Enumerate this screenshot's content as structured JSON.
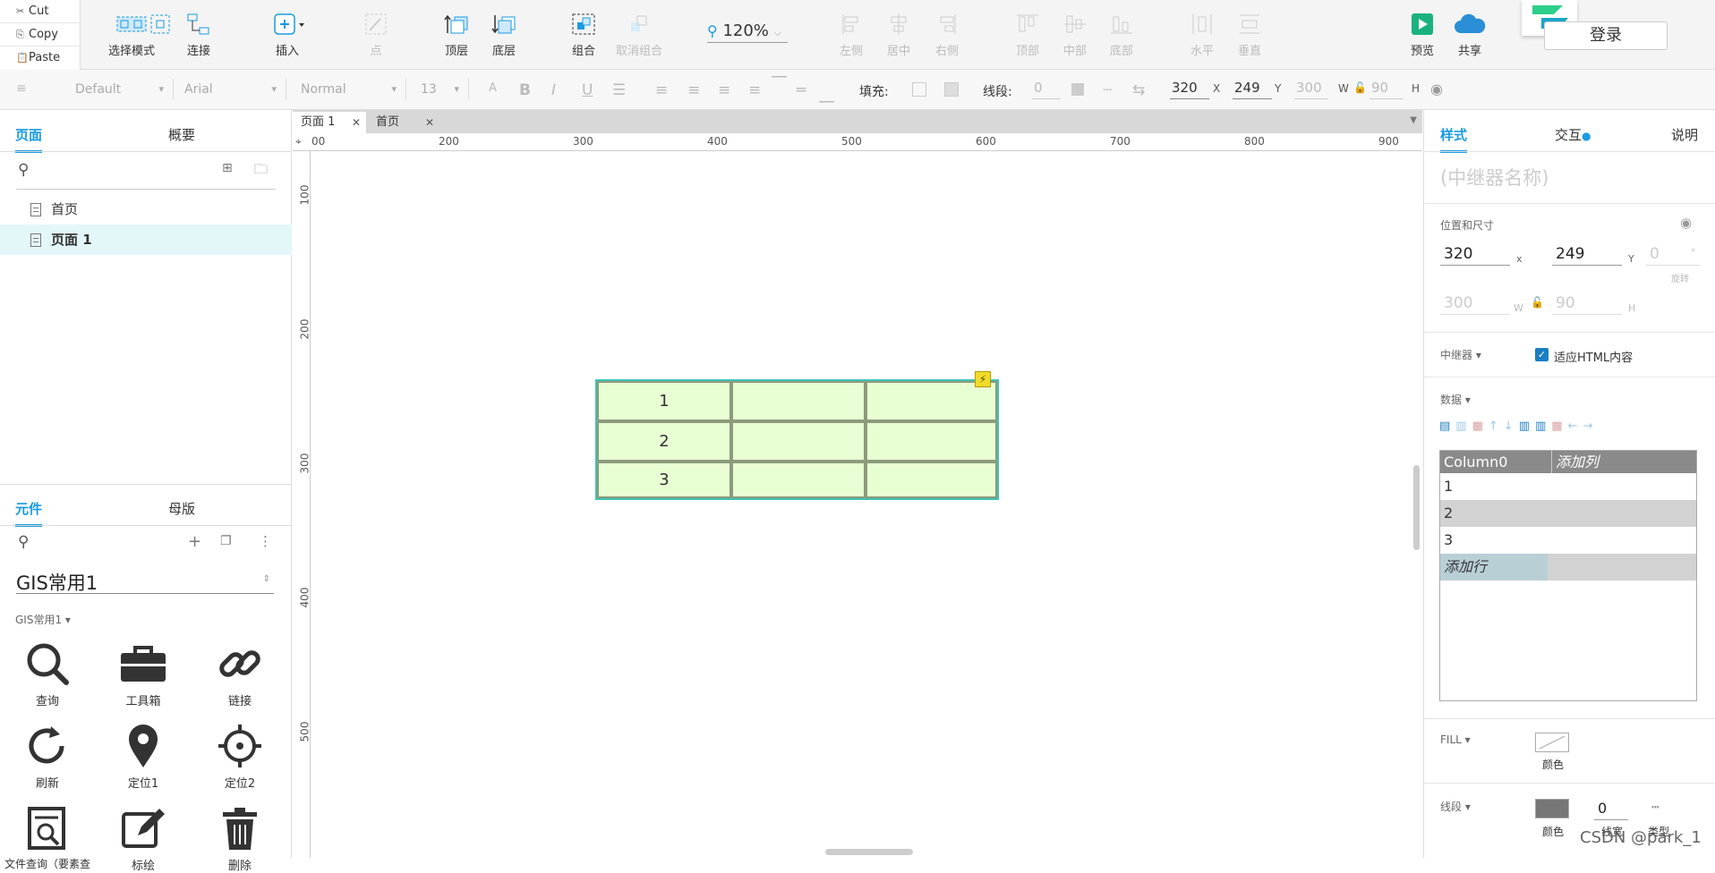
{
  "clipboard": {
    "cut": "Cut",
    "copy": "Copy",
    "paste": "Paste"
  },
  "toolbar": {
    "select_mode": "选择模式",
    "connect": "连接",
    "insert": "插入",
    "point": "点",
    "top_layer": "顶层",
    "bottom_layer": "底层",
    "group": "组合",
    "ungroup": "取消组合",
    "zoom": "120%",
    "align_left": "左侧",
    "align_center": "居中",
    "align_right": "右侧",
    "align_top": "顶部",
    "align_middle": "中部",
    "align_bottom": "底部",
    "dist_horizontal": "水平",
    "dist_vertical": "垂直",
    "preview": "预览",
    "share": "共享",
    "login": "登录"
  },
  "format": {
    "style": "Default",
    "font": "Arial",
    "weight": "Normal",
    "size": "13",
    "fill_label": "填充:",
    "stroke_label": "线段:",
    "stroke_value": "0",
    "x": "320",
    "x_label": "X",
    "y": "249",
    "y_label": "Y",
    "w": "300",
    "w_label": "W",
    "h": "90",
    "h_label": "H"
  },
  "left": {
    "tab_pages": "页面",
    "tab_outline": "概要",
    "pages": [
      "首页",
      "页面 1"
    ],
    "tab_widgets": "元件",
    "tab_masters": "母版",
    "library_name": "GIS常用1",
    "library_group": "GIS常用1 ▾",
    "widgets": [
      "查询",
      "工具箱",
      "链接",
      "刷新",
      "定位1",
      "定位2",
      "文件查询（要素查",
      "标绘",
      "删除"
    ]
  },
  "canvas": {
    "tabs": [
      "页面 1",
      "首页"
    ],
    "ruler_h": [
      "00",
      "200",
      "300",
      "400",
      "500",
      "600",
      "700",
      "800",
      "900"
    ],
    "ruler_v": [
      "100",
      "200",
      "300",
      "400",
      "500"
    ],
    "rows": [
      "1",
      "2",
      "3"
    ]
  },
  "right": {
    "tab_style": "样式",
    "tab_interaction": "交互",
    "tab_notes": "说明",
    "repeater_name_placeholder": "(中继器名称)",
    "pos_size": "位置和尺寸",
    "x": "320",
    "x_label": "x",
    "y": "249",
    "y_label": "Y",
    "rot": "0",
    "rot_unit": "°",
    "rot_label": "旋转",
    "w": "300",
    "w_label": "W",
    "h": "90",
    "h_label": "H",
    "repeater": "中继器 ▾",
    "fit_html": "适应HTML内容",
    "data": "数据 ▾",
    "col0": "Column0",
    "add_col": "添加列",
    "rows": [
      "1",
      "2",
      "3"
    ],
    "add_row": "添加行",
    "fill": "FILL ▾",
    "color": "颜色",
    "stroke": "线段 ▾",
    "stroke_color": "颜色",
    "stroke_width": "0",
    "stroke_width_label": "线宽",
    "stroke_type": "类型"
  },
  "watermark": "CSDN @park_1",
  "colors": {
    "accent": "#1a9be0",
    "repeater_fill": "#e8ffd4",
    "repeater_border": "#3cc4b4",
    "preview": "#19b27f",
    "share": "#2a8fd6"
  }
}
